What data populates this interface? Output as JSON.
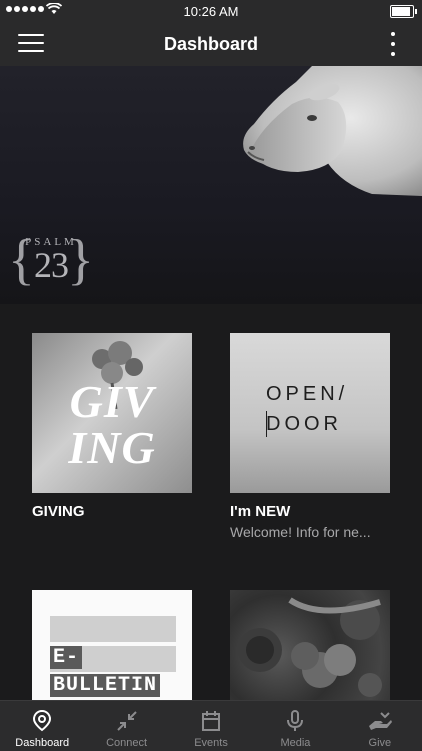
{
  "status_bar": {
    "time": "10:26 AM"
  },
  "nav": {
    "title": "Dashboard"
  },
  "hero": {
    "logo_word": "PSALM",
    "logo_number": "23"
  },
  "cards": [
    {
      "title": "GIVING",
      "subtitle": "",
      "thumb_text": [
        "GIV",
        "ING"
      ]
    },
    {
      "title": "I'm NEW",
      "subtitle": "Welcome! Info for ne...",
      "thumb_text": [
        "OPEN/",
        "DOOR"
      ]
    },
    {
      "title": "",
      "subtitle": "",
      "thumb_text": [
        "E-",
        "BULLETIN"
      ]
    },
    {
      "title": "",
      "subtitle": "",
      "thumb_text": []
    }
  ],
  "tabs": [
    {
      "label": "Dashboard",
      "icon": "location-pin-icon",
      "active": true
    },
    {
      "label": "Connect",
      "icon": "collapse-arrows-icon",
      "active": false
    },
    {
      "label": "Events",
      "icon": "calendar-icon",
      "active": false
    },
    {
      "label": "Media",
      "icon": "microphone-icon",
      "active": false
    },
    {
      "label": "Give",
      "icon": "giving-hand-icon",
      "active": false
    }
  ],
  "colors": {
    "background": "#1b1b1c",
    "bar": "#2a2a2b",
    "tab_inactive": "#8c8c8e",
    "tab_active": "#ffffff"
  }
}
